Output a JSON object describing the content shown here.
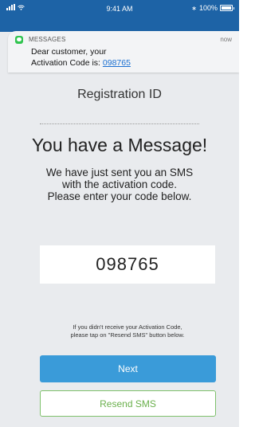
{
  "status_bar": {
    "time": "9:41 AM",
    "battery": "100%"
  },
  "notification": {
    "app_name": "MESSAGES",
    "time": "now",
    "line1": "Dear customer, your",
    "line2_prefix": "Activation Code is: ",
    "code": "098765"
  },
  "main": {
    "title": "Registration ID",
    "headline": "You have a Message!",
    "instruction_1": "We have just sent you an SMS",
    "instruction_2": "with the activation code.",
    "instruction_3": "Please enter your code below.",
    "code_value": "098765",
    "resend_note_1": "If you didn't receive your Activation Code,",
    "resend_note_2": "please tap on \"Resend SMS\" button below.",
    "next_label": "Next",
    "resend_label": "Resend SMS"
  },
  "colors": {
    "header_blue": "#1d63a6",
    "next_blue": "#3a9bd9",
    "resend_green": "#7ec16b",
    "background": "#e9ebee"
  }
}
